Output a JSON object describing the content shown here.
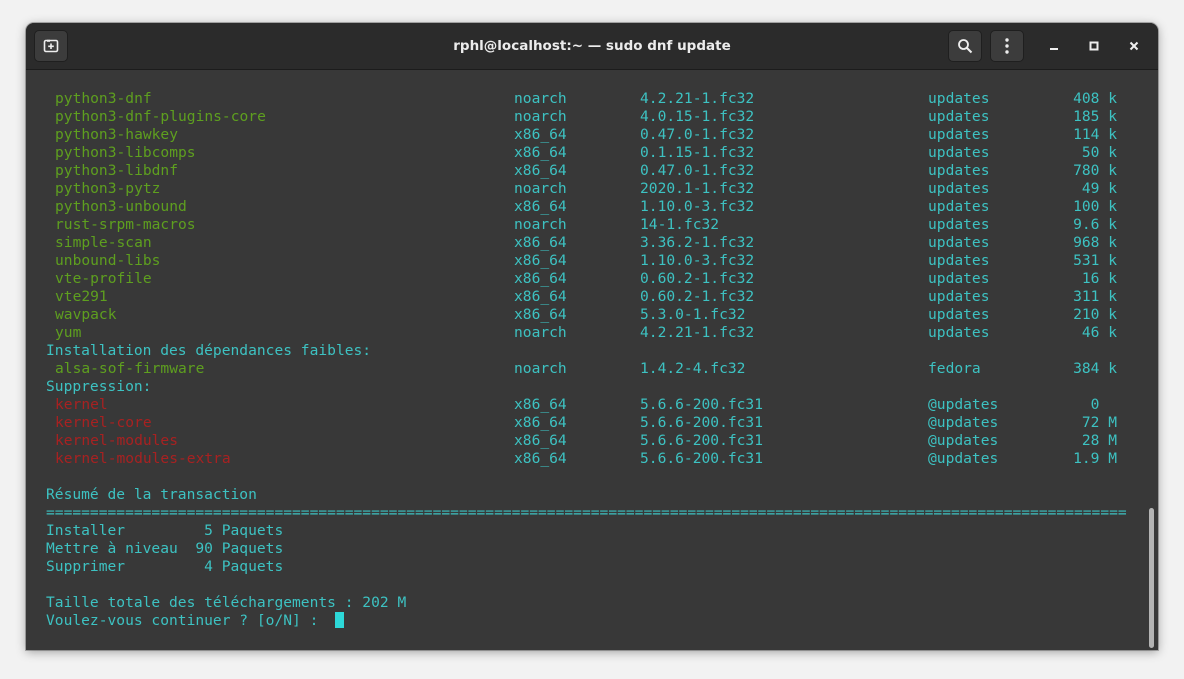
{
  "window": {
    "title": "rphl@localhost:~ — sudo dnf update",
    "icons": {
      "new_tab": "new-tab-icon",
      "search": "search-icon",
      "menu": "kebab-menu-icon",
      "minimize": "minimize-icon",
      "maximize": "maximize-icon",
      "close": "close-icon"
    }
  },
  "colors": {
    "package": "#5e9f1f",
    "removed": "#a82121",
    "text": "#3dc2c2",
    "cursor": "#2dd8d8"
  },
  "terminal": {
    "update_rows": [
      {
        "name": "python3-dnf",
        "arch": "noarch",
        "version": "4.2.21-1.fc32",
        "repo": "updates",
        "size": "408 k"
      },
      {
        "name": "python3-dnf-plugins-core",
        "arch": "noarch",
        "version": "4.0.15-1.fc32",
        "repo": "updates",
        "size": "185 k"
      },
      {
        "name": "python3-hawkey",
        "arch": "x86_64",
        "version": "0.47.0-1.fc32",
        "repo": "updates",
        "size": "114 k"
      },
      {
        "name": "python3-libcomps",
        "arch": "x86_64",
        "version": "0.1.15-1.fc32",
        "repo": "updates",
        "size": "50 k"
      },
      {
        "name": "python3-libdnf",
        "arch": "x86_64",
        "version": "0.47.0-1.fc32",
        "repo": "updates",
        "size": "780 k"
      },
      {
        "name": "python3-pytz",
        "arch": "noarch",
        "version": "2020.1-1.fc32",
        "repo": "updates",
        "size": "49 k"
      },
      {
        "name": "python3-unbound",
        "arch": "x86_64",
        "version": "1.10.0-3.fc32",
        "repo": "updates",
        "size": "100 k"
      },
      {
        "name": "rust-srpm-macros",
        "arch": "noarch",
        "version": "14-1.fc32",
        "repo": "updates",
        "size": "9.6 k"
      },
      {
        "name": "simple-scan",
        "arch": "x86_64",
        "version": "3.36.2-1.fc32",
        "repo": "updates",
        "size": "968 k"
      },
      {
        "name": "unbound-libs",
        "arch": "x86_64",
        "version": "1.10.0-3.fc32",
        "repo": "updates",
        "size": "531 k"
      },
      {
        "name": "vte-profile",
        "arch": "x86_64",
        "version": "0.60.2-1.fc32",
        "repo": "updates",
        "size": "16 k"
      },
      {
        "name": "vte291",
        "arch": "x86_64",
        "version": "0.60.2-1.fc32",
        "repo": "updates",
        "size": "311 k"
      },
      {
        "name": "wavpack",
        "arch": "x86_64",
        "version": "5.3.0-1.fc32",
        "repo": "updates",
        "size": "210 k"
      },
      {
        "name": "yum",
        "arch": "noarch",
        "version": "4.2.21-1.fc32",
        "repo": "updates",
        "size": "46 k"
      }
    ],
    "weak_deps_header": "Installation des dépendances faibles:",
    "weak_deps_rows": [
      {
        "name": "alsa-sof-firmware",
        "arch": "noarch",
        "version": "1.4.2-4.fc32",
        "repo": "fedora",
        "size": "384 k"
      }
    ],
    "removal_header": "Suppression:",
    "removal_rows": [
      {
        "name": "kernel",
        "arch": "x86_64",
        "version": "5.6.6-200.fc31",
        "repo": "@updates",
        "size": "0  "
      },
      {
        "name": "kernel-core",
        "arch": "x86_64",
        "version": "5.6.6-200.fc31",
        "repo": "@updates",
        "size": "72 M"
      },
      {
        "name": "kernel-modules",
        "arch": "x86_64",
        "version": "5.6.6-200.fc31",
        "repo": "@updates",
        "size": "28 M"
      },
      {
        "name": "kernel-modules-extra",
        "arch": "x86_64",
        "version": "5.6.6-200.fc31",
        "repo": "@updates",
        "size": "1.9 M"
      }
    ],
    "summary_title": "Résumé de la transaction",
    "separator": "===========================================================================================================================",
    "summary_lines": [
      "Installer         5 Paquets",
      "Mettre à niveau  90 Paquets",
      "Supprimer         4 Paquets"
    ],
    "download_size": "Taille totale des téléchargements : 202 M",
    "prompt": "Voulez-vous continuer ? [o/N] : "
  }
}
